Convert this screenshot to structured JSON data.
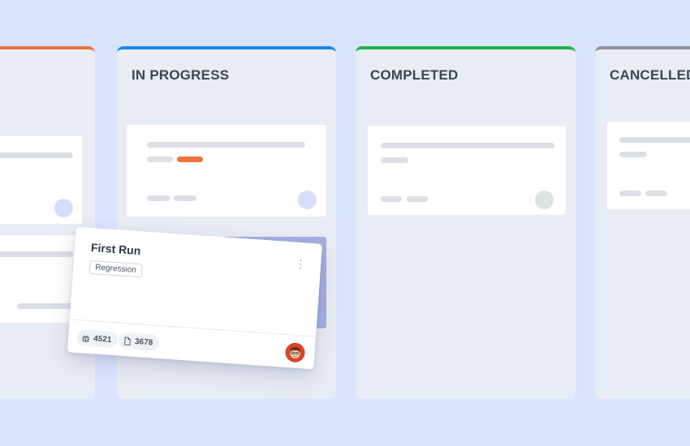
{
  "columns": [
    {
      "id": "todo",
      "title": "",
      "accent": "#e8743b"
    },
    {
      "id": "in_progress",
      "title": "IN PROGRESS",
      "accent": "#1e88e5"
    },
    {
      "id": "completed",
      "title": "COMPLETED",
      "accent": "#22b24c"
    },
    {
      "id": "cancelled",
      "title": "CANCELLED",
      "accent": "#8e9399"
    }
  ],
  "drag_card": {
    "title": "First Run",
    "tag": "Regression",
    "bugs_count": "4521",
    "files_count": "3678",
    "icons": {
      "menu": "kebab-menu-icon",
      "bugs": "bug-icon",
      "files": "file-icon",
      "avatar": "user-avatar"
    }
  },
  "colors": {
    "background": "#d9e4ff",
    "column": "#e8ecf3",
    "drop_zone": "#a3b0e0",
    "tag_accent": "#e8743b"
  }
}
